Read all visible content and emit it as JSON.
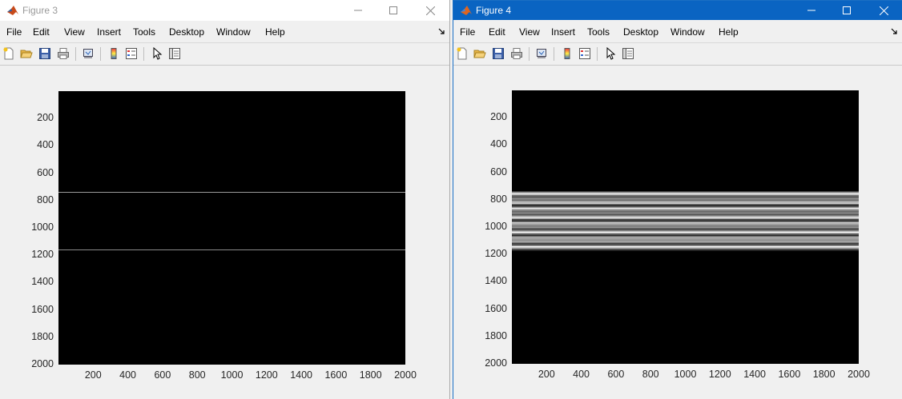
{
  "figure3": {
    "title": "Figure 3",
    "menu": [
      "File",
      "Edit",
      "View",
      "Insert",
      "Tools",
      "Desktop",
      "Window",
      "Help"
    ],
    "y_ticks": [
      "200",
      "400",
      "600",
      "800",
      "1000",
      "1200",
      "1400",
      "1600",
      "1800",
      "2000"
    ],
    "x_ticks": [
      "200",
      "400",
      "600",
      "800",
      "1000",
      "1200",
      "1400",
      "1600",
      "1800",
      "2000"
    ]
  },
  "figure4": {
    "title": "Figure 4",
    "menu": [
      "File",
      "Edit",
      "View",
      "Insert",
      "Tools",
      "Desktop",
      "Window",
      "Help"
    ],
    "y_ticks": [
      "200",
      "400",
      "600",
      "800",
      "1000",
      "1200",
      "1400",
      "1600",
      "1800",
      "2000"
    ],
    "x_ticks": [
      "200",
      "400",
      "600",
      "800",
      "1000",
      "1200",
      "1400",
      "1600",
      "1800",
      "2000"
    ]
  },
  "toolbar_icons": [
    "new-figure-icon",
    "open-file-icon",
    "save-icon",
    "print-icon",
    "link-plot-icon",
    "colorbar-icon",
    "legend-icon",
    "edit-plot-arrow-icon",
    "property-inspector-icon"
  ],
  "chart_data": [
    {
      "type": "heatmap",
      "figure": "Figure 3",
      "description_lines_y": [
        740,
        1170
      ],
      "xlim": [
        1,
        2000
      ],
      "ylim": [
        1,
        2000
      ],
      "y_reversed": true,
      "colormap": "gray",
      "background_color": "#000000",
      "line_color": "#9a9a9a"
    },
    {
      "type": "heatmap",
      "figure": "Figure 4",
      "band_y": [
        740,
        1170
      ],
      "xlim": [
        1,
        2000
      ],
      "ylim": [
        1,
        2000
      ],
      "y_reversed": true,
      "colormap": "gray",
      "background_color": "#000000",
      "band_pattern": "horizontal stripes of varying intensity"
    }
  ]
}
